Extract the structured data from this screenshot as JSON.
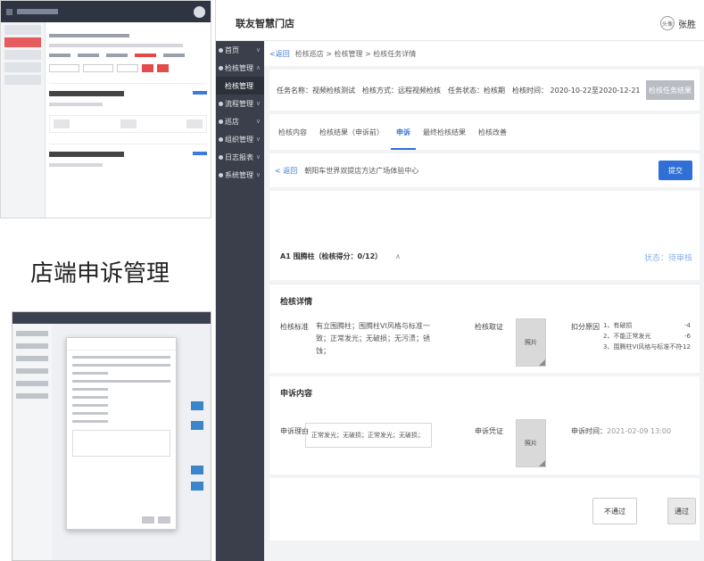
{
  "caption": "店端申诉管理",
  "header": {
    "brand": "联友智慧门店",
    "avatar_text": "头像",
    "user_name": "张胜"
  },
  "sidebar": {
    "items": [
      {
        "label": "首页",
        "sub": false
      },
      {
        "label": "检核管理",
        "sub": false
      },
      {
        "label": "检核管理",
        "sub": true
      },
      {
        "label": "流程管理",
        "sub": false
      },
      {
        "label": "巡店",
        "sub": false
      },
      {
        "label": "组织管理",
        "sub": false
      },
      {
        "label": "日志报表",
        "sub": false
      },
      {
        "label": "系统管理",
        "sub": false
      }
    ]
  },
  "breadcrumb": {
    "back": "<返回",
    "path": "检核巡店 > 检核管理 > 检核任务详情"
  },
  "task": {
    "name": "任务名称：视频检核测试",
    "method": "检核方式：远程视频检核",
    "status": "任务状态：检核期",
    "time": "检核时间：  2020-10-22至2020-12-21",
    "button": "检核任务结果"
  },
  "tabs": [
    {
      "label": "检核内容",
      "active": false
    },
    {
      "label": "检核结果（申诉前）",
      "active": false
    },
    {
      "label": "申诉",
      "active": true
    },
    {
      "label": "最终检核结果",
      "active": false
    },
    {
      "label": "检核改善",
      "active": false
    }
  ],
  "store": {
    "back": "< 返回",
    "name": "朝阳车世界双提店方达广场体验中心",
    "submit": "提交"
  },
  "item": {
    "title": "A1 围腾柱（检核得分：0/12）",
    "toggle": "∧",
    "status": "状态：待审核"
  },
  "details": {
    "title": "检核详情",
    "standard_label": "检核标准",
    "standard_text": "有立围腾柱；围腾柱VI风格与标准一致；正常发光；无破损；无污渍；锈蚀；",
    "evidence_label": "检核取证",
    "photo": "照片",
    "deduct_label": "扣分原因",
    "reasons": [
      {
        "text": "1、有破损",
        "score": "-4"
      },
      {
        "text": "2、不能正常发光",
        "score": "-6"
      },
      {
        "text": "3、围腾柱VI风格与标准不符",
        "score": "-12"
      }
    ]
  },
  "appeal": {
    "title": "申诉内容",
    "reason_label": "申诉理由",
    "reason_text": "正常发光；无破损；正常发光；无破损；",
    "proof_label": "申诉凭证",
    "photo": "照片",
    "time_label": "申诉时间：",
    "time_value": "2021-02-09 13:00"
  },
  "actions": {
    "reject": "不通过",
    "pass": "通过"
  }
}
